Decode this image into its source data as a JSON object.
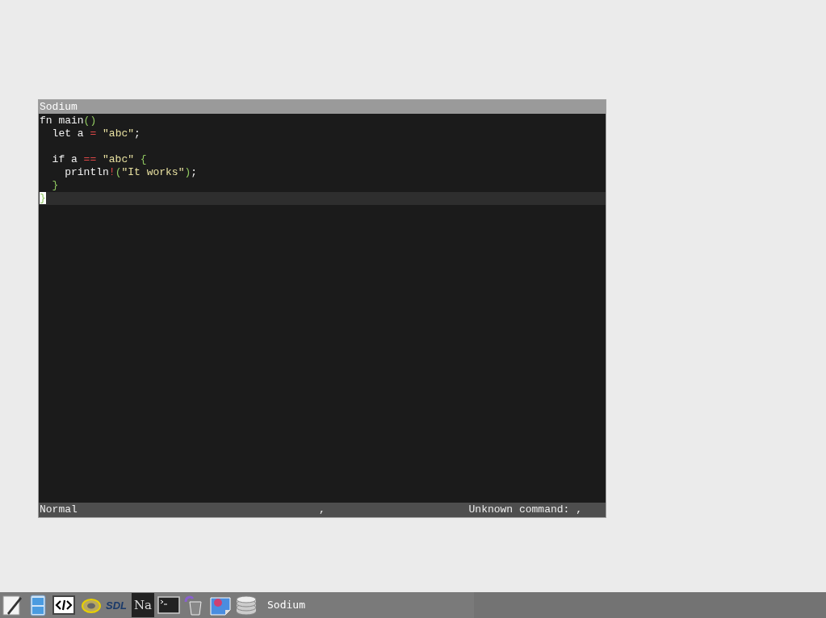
{
  "window": {
    "title": "Sodium"
  },
  "editor": {
    "lines": [
      {
        "current": false,
        "tokens": [
          {
            "text": "fn main",
            "kind": "plain"
          },
          {
            "text": "()",
            "kind": "paren"
          }
        ]
      },
      {
        "current": false,
        "tokens": [
          {
            "text": "  let a ",
            "kind": "plain"
          },
          {
            "text": "= ",
            "kind": "op"
          },
          {
            "text": "\"abc\"",
            "kind": "string"
          },
          {
            "text": ";",
            "kind": "plain"
          }
        ]
      },
      {
        "current": false
      },
      {
        "current": false,
        "tokens": [
          {
            "text": "  if a ",
            "kind": "plain"
          },
          {
            "text": "== ",
            "kind": "op"
          },
          {
            "text": "\"abc\"",
            "kind": "string"
          },
          {
            "text": " {",
            "kind": "paren"
          }
        ]
      },
      {
        "current": false,
        "tokens": [
          {
            "text": "    println",
            "kind": "plain"
          },
          {
            "text": "!",
            "kind": "op"
          },
          {
            "text": "(",
            "kind": "paren"
          },
          {
            "text": "\"It works\"",
            "kind": "string"
          },
          {
            "text": ")",
            "kind": "paren"
          },
          {
            "text": ";",
            "kind": "plain"
          }
        ]
      },
      {
        "current": false,
        "tokens": [
          {
            "text": "  }",
            "kind": "paren"
          }
        ]
      },
      {
        "current": true,
        "tokens": [
          {
            "text": "}",
            "kind": "cursor"
          }
        ]
      }
    ]
  },
  "status_bar": {
    "mode": "Normal",
    "middle": ",",
    "message": "Unknown command: ,"
  },
  "taskbar": {
    "launchers": [
      {
        "kind": "pencil"
      },
      {
        "kind": "cabinet"
      },
      {
        "kind": "code"
      },
      {
        "kind": "speaker"
      },
      {
        "kind": "sdl",
        "label": "SDL"
      },
      {
        "kind": "na",
        "label": "Na"
      },
      {
        "kind": "terminal"
      },
      {
        "kind": "trash"
      },
      {
        "kind": "image"
      },
      {
        "kind": "database"
      }
    ],
    "tasks": [
      {
        "label": "Sodium"
      }
    ]
  }
}
